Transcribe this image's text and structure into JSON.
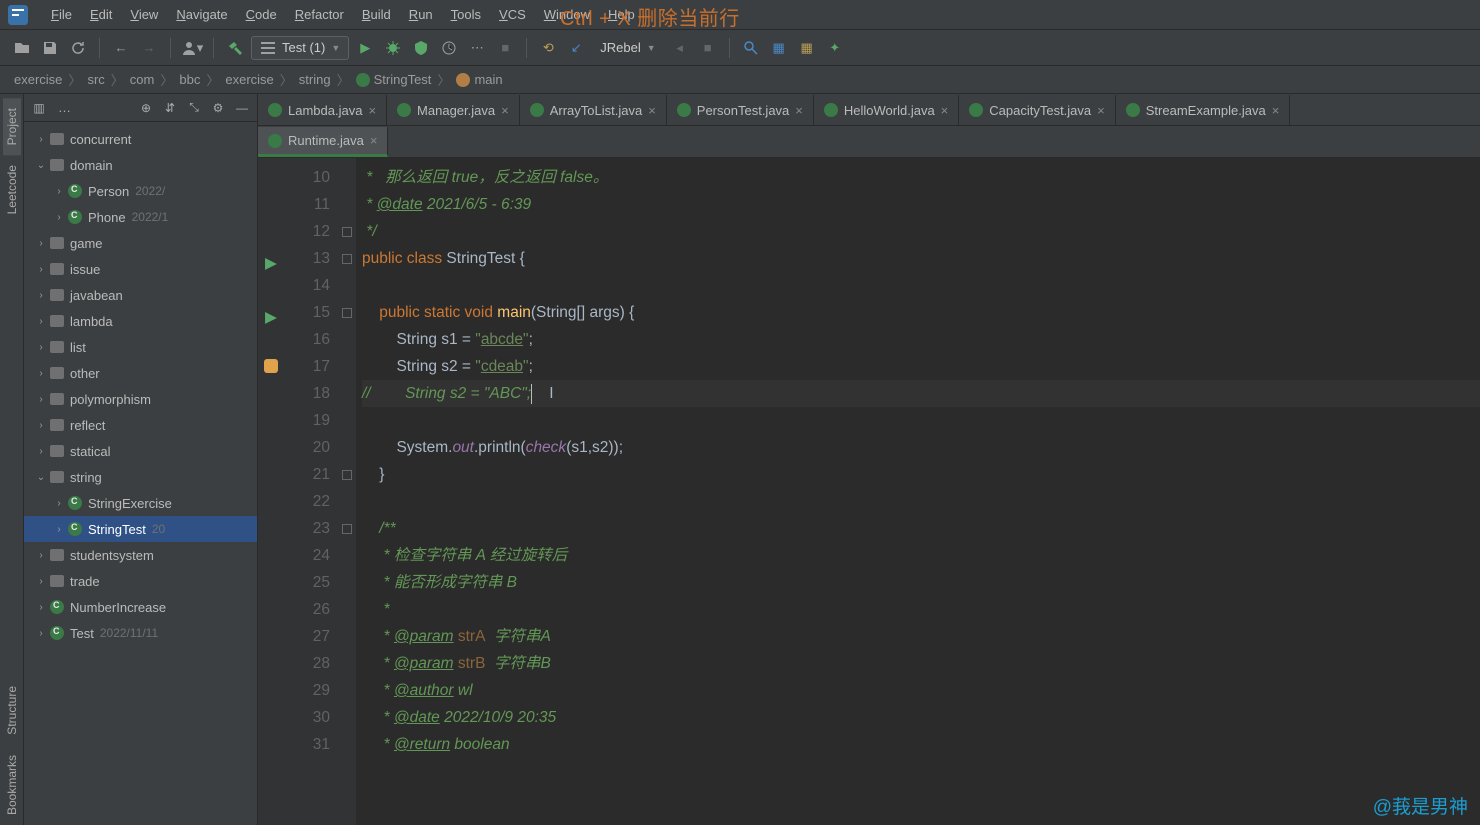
{
  "menu": {
    "items": [
      "File",
      "Edit",
      "View",
      "Navigate",
      "Code",
      "Refactor",
      "Build",
      "Run",
      "Tools",
      "VCS",
      "Window",
      "Help"
    ],
    "hint": "Ctrl + X  删除当前行"
  },
  "toolbar": {
    "run_config_label": "Test (1)",
    "jrebel_label": "JRebel"
  },
  "breadcrumb": {
    "items": [
      "exercise",
      "src",
      "com",
      "bbc",
      "exercise",
      "string",
      "StringTest",
      "main"
    ]
  },
  "sidestrip": {
    "top": [
      "Project",
      "Leetcode"
    ],
    "bottom": [
      "Structure",
      "Bookmarks"
    ]
  },
  "project_header": {
    "dots": "…"
  },
  "tree": [
    {
      "level": 1,
      "kind": "folder",
      "arrow": "›",
      "label": "concurrent"
    },
    {
      "level": 1,
      "kind": "folder",
      "arrow": "⌄",
      "label": "domain"
    },
    {
      "level": 2,
      "kind": "class",
      "arrow": "›",
      "label": "Person",
      "meta": "2022/"
    },
    {
      "level": 2,
      "kind": "class",
      "arrow": "›",
      "label": "Phone",
      "meta": "2022/1"
    },
    {
      "level": 1,
      "kind": "folder",
      "arrow": "›",
      "label": "game"
    },
    {
      "level": 1,
      "kind": "folder",
      "arrow": "›",
      "label": "issue"
    },
    {
      "level": 1,
      "kind": "folder",
      "arrow": "›",
      "label": "javabean"
    },
    {
      "level": 1,
      "kind": "folder",
      "arrow": "›",
      "label": "lambda"
    },
    {
      "level": 1,
      "kind": "folder",
      "arrow": "›",
      "label": "list"
    },
    {
      "level": 1,
      "kind": "folder",
      "arrow": "›",
      "label": "other"
    },
    {
      "level": 1,
      "kind": "folder",
      "arrow": "›",
      "label": "polymorphism"
    },
    {
      "level": 1,
      "kind": "folder",
      "arrow": "›",
      "label": "reflect"
    },
    {
      "level": 1,
      "kind": "folder",
      "arrow": "›",
      "label": "statical"
    },
    {
      "level": 1,
      "kind": "folder",
      "arrow": "⌄",
      "label": "string"
    },
    {
      "level": 2,
      "kind": "class",
      "arrow": "›",
      "label": "StringExercise"
    },
    {
      "level": 2,
      "kind": "class",
      "arrow": "›",
      "label": "StringTest",
      "meta": "20",
      "selected": true
    },
    {
      "level": 1,
      "kind": "folder",
      "arrow": "›",
      "label": "studentsystem"
    },
    {
      "level": 1,
      "kind": "folder",
      "arrow": "›",
      "label": "trade"
    },
    {
      "level": 1,
      "kind": "class",
      "arrow": "›",
      "label": "NumberIncrease"
    },
    {
      "level": 1,
      "kind": "class",
      "arrow": "›",
      "label": "Test",
      "meta": "2022/11/11"
    }
  ],
  "tabs_row1": [
    "Lambda.java",
    "Manager.java",
    "ArrayToList.java",
    "PersonTest.java",
    "HelloWorld.java",
    "CapacityTest.java",
    "StreamExample.java"
  ],
  "tabs_row2": [
    {
      "label": "Runtime.java",
      "active": true
    }
  ],
  "editor": {
    "first_line_no": 10,
    "lines": [
      {
        "no": 10,
        "html": "<span class='cmt'> *   那么返回 true，反之返回 false。</span>"
      },
      {
        "no": 11,
        "html": "<span class='cmt'> * <span class='tag'>@date</span> 2021/6/5 - 6:39</span>"
      },
      {
        "no": 12,
        "html": "<span class='cmt'> */</span>",
        "fold": true
      },
      {
        "no": 13,
        "html": "<span class='kw'>public class</span> StringTest {",
        "run": true,
        "fold": true
      },
      {
        "no": 14,
        "html": ""
      },
      {
        "no": 15,
        "html": "    <span class='kw'>public static void</span> <span class='fn'>main</span>(String[] args) {",
        "run": true,
        "fold": true
      },
      {
        "no": 16,
        "html": "        String s1 = <span class='str'>\"<span class='ul'>abcde</span>\"</span>;"
      },
      {
        "no": 17,
        "html": "        String s2 = <span class='str'>\"<span class='ul'>cdeab</span>\"</span>;",
        "bulb": true
      },
      {
        "no": 18,
        "html": "<span class='cmt'>//        String s2 = \"ABC\";</span><span class='cursor'></span>    I",
        "hl": true
      },
      {
        "no": 19,
        "html": ""
      },
      {
        "no": 20,
        "html": "        System.<span class='it'>out</span>.println(<span class='it'>check</span>(s1,s2));"
      },
      {
        "no": 21,
        "html": "    }",
        "fold": true
      },
      {
        "no": 22,
        "html": ""
      },
      {
        "no": 23,
        "html": "    <span class='cmt'>/**</span>",
        "fold": true
      },
      {
        "no": 24,
        "html": "<span class='cmt'>     * 检查字符串 A 经过旋转后</span>"
      },
      {
        "no": 25,
        "html": "<span class='cmt'>     * 能否形成字符串 B</span>"
      },
      {
        "no": 26,
        "html": "<span class='cmt'>     *</span>"
      },
      {
        "no": 27,
        "html": "<span class='cmt'>     * <span class='tag'>@param</span> <span style='font-style:normal;color:#8a653b'>strA</span>  字符串A</span>"
      },
      {
        "no": 28,
        "html": "<span class='cmt'>     * <span class='tag'>@param</span> <span style='font-style:normal;color:#8a653b'>strB</span>  字符串B</span>"
      },
      {
        "no": 29,
        "html": "<span class='cmt'>     * <span class='tag'>@author</span> wl</span>"
      },
      {
        "no": 30,
        "html": "<span class='cmt'>     * <span class='tag'>@date</span> 2022/10/9 20:35</span>"
      },
      {
        "no": 31,
        "html": "<span class='cmt'>     * <span class='tag'>@return</span> boolean</span>"
      }
    ]
  },
  "watermark": "@莪是男神"
}
